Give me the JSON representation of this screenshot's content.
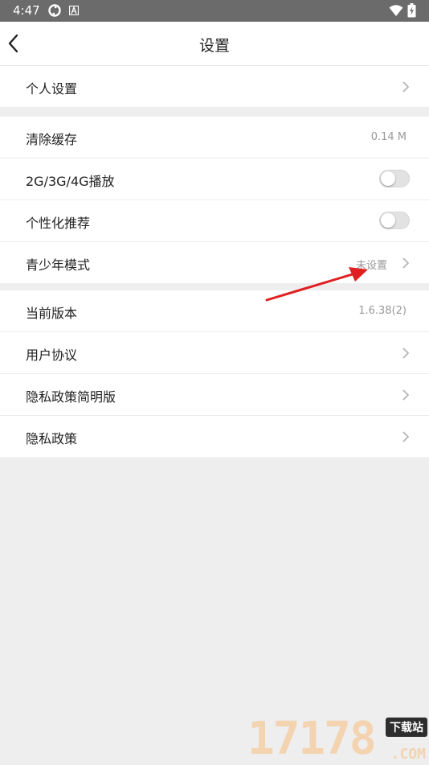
{
  "status_bar": {
    "time": "4:47",
    "icons": [
      "sync-icon",
      "a-badge-icon",
      "wifi-icon",
      "battery-charging-icon"
    ]
  },
  "app_bar": {
    "back_icon": "chevron-left-icon",
    "title": "设置"
  },
  "groups": [
    {
      "rows": [
        {
          "label": "个人设置",
          "accessory": "chevron"
        }
      ]
    },
    {
      "rows": [
        {
          "label": "清除缓存",
          "value": "0.14 M"
        },
        {
          "label": "2G/3G/4G播放",
          "accessory": "toggle",
          "toggle_on": false
        },
        {
          "label": "个性化推荐",
          "accessory": "toggle",
          "toggle_on": false
        },
        {
          "label": "青少年模式",
          "value": "未设置",
          "accessory": "chevron"
        }
      ]
    },
    {
      "rows": [
        {
          "label": "当前版本",
          "value": "1.6.38(2)"
        },
        {
          "label": "用户协议",
          "accessory": "chevron"
        },
        {
          "label": "隐私政策简明版",
          "accessory": "chevron"
        },
        {
          "label": "隐私政策",
          "accessory": "chevron"
        }
      ]
    }
  ],
  "annotation": {
    "color": "#e02020"
  },
  "watermark": {
    "digits": "17178",
    "badge": "下载站",
    "domain": ".COM"
  },
  "colors": {
    "status_bar": "#6b6b6b",
    "page_background": "#eeeeee",
    "row_background": "#ffffff",
    "secondary_text": "#999999"
  }
}
